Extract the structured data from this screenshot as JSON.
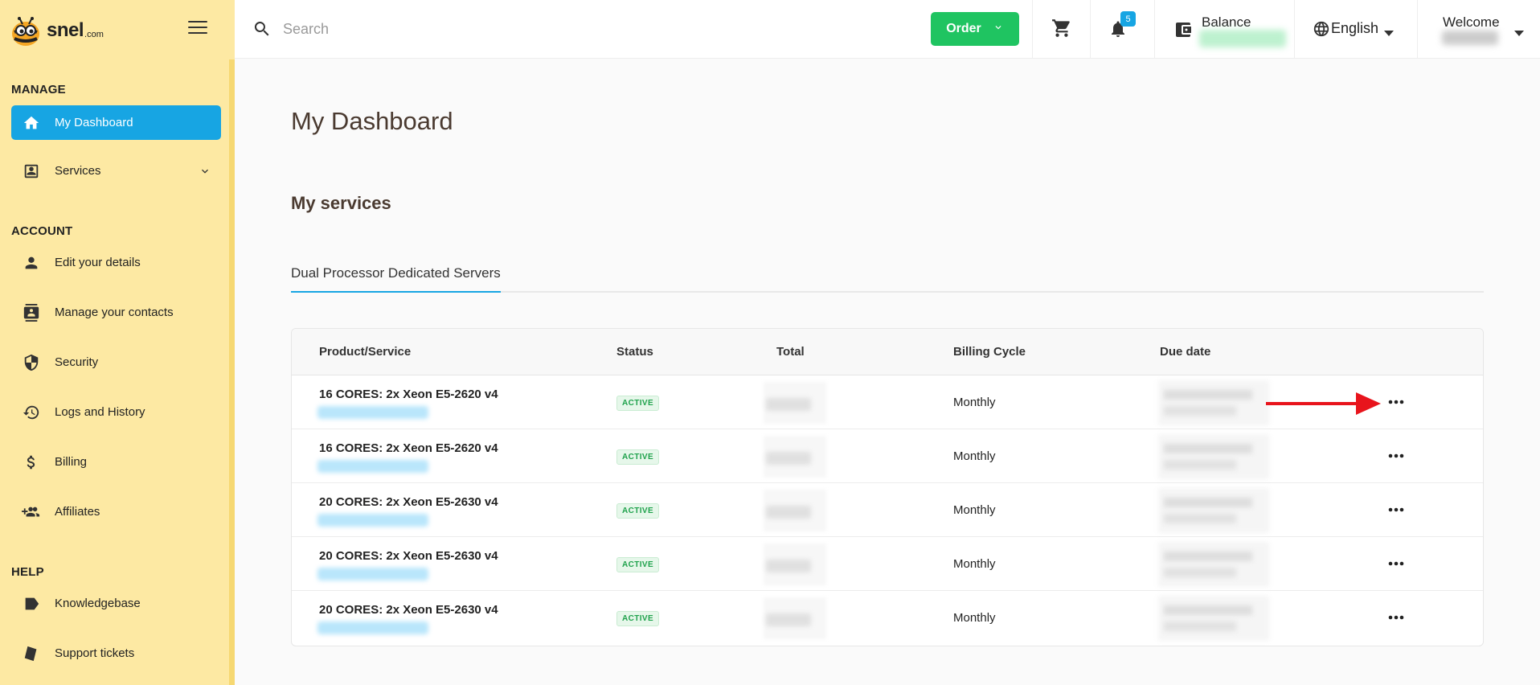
{
  "brand": {
    "name": "snel",
    "suffix": ".com"
  },
  "sidebar": {
    "sections": {
      "manage": "MANAGE",
      "account": "ACCOUNT",
      "help": "HELP"
    },
    "items": [
      {
        "label": "My Dashboard",
        "icon": "home-icon"
      },
      {
        "label": "Services",
        "icon": "account-box-icon"
      },
      {
        "label": "Edit your details",
        "icon": "person-icon"
      },
      {
        "label": "Manage your contacts",
        "icon": "contacts-icon"
      },
      {
        "label": "Security",
        "icon": "shield-icon"
      },
      {
        "label": "Logs and History",
        "icon": "history-icon"
      },
      {
        "label": "Billing",
        "icon": "dollar-icon"
      },
      {
        "label": "Affiliates",
        "icon": "group-add-icon"
      },
      {
        "label": "Knowledgebase",
        "icon": "label-icon"
      },
      {
        "label": "Support tickets",
        "icon": "ticket-icon"
      }
    ]
  },
  "header": {
    "search_placeholder": "Search",
    "order_label": "Order",
    "notifications_count": "5",
    "balance_label": "Balance",
    "language": "English",
    "welcome_label": "Welcome"
  },
  "main": {
    "title": "My Dashboard",
    "services_heading": "My services",
    "tabs": [
      "Dual Processor Dedicated Servers"
    ],
    "table": {
      "columns": [
        "Product/Service",
        "Status",
        "Total",
        "Billing Cycle",
        "Due date"
      ],
      "rows": [
        {
          "product": "16 CORES: 2x Xeon E5-2620 v4",
          "status": "ACTIVE",
          "cycle": "Monthly"
        },
        {
          "product": "16 CORES: 2x Xeon E5-2620 v4",
          "status": "ACTIVE",
          "cycle": "Monthly"
        },
        {
          "product": "20 CORES: 2x Xeon E5-2630 v4",
          "status": "ACTIVE",
          "cycle": "Monthly"
        },
        {
          "product": "20 CORES: 2x Xeon E5-2630 v4",
          "status": "ACTIVE",
          "cycle": "Monthly"
        },
        {
          "product": "20 CORES: 2x Xeon E5-2630 v4",
          "status": "ACTIVE",
          "cycle": "Monthly"
        }
      ]
    }
  },
  "colors": {
    "sidebar_bg": "#fde9a3",
    "accent_blue": "#17a5e3",
    "order_green": "#1fc461",
    "annotation_arrow": "#e8141c"
  }
}
